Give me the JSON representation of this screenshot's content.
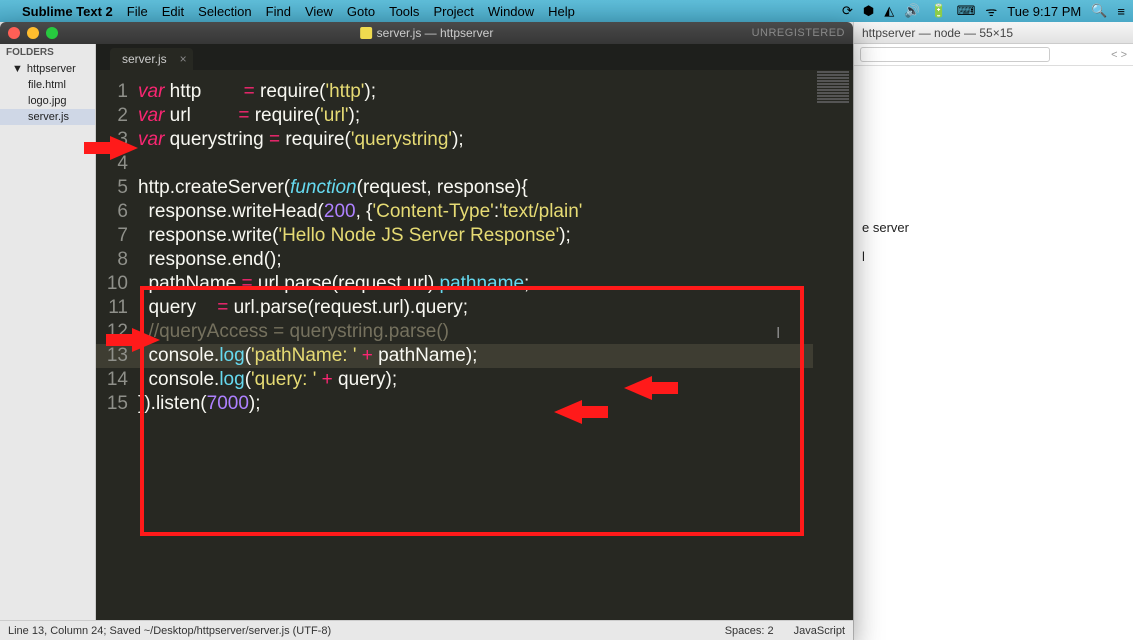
{
  "menubar": {
    "app": "Sublime Text 2",
    "items": [
      "File",
      "Edit",
      "Selection",
      "Find",
      "View",
      "Goto",
      "Tools",
      "Project",
      "Window",
      "Help"
    ],
    "clock": "Tue 9:17 PM"
  },
  "sublime": {
    "title": "server.js — httpserver",
    "unregistered": "UNREGISTERED",
    "sidebar": {
      "header": "FOLDERS",
      "folder": "httpserver",
      "files": [
        "file.html",
        "logo.jpg",
        "server.js"
      ],
      "selected": "server.js"
    },
    "tab": {
      "label": "server.js"
    },
    "status": {
      "left": "Line 13, Column 24; Saved ~/Desktop/httpserver/server.js (UTF-8)",
      "spaces": "Spaces: 2",
      "lang": "JavaScript"
    },
    "code": {
      "l1": {
        "n": "1",
        "pre": "",
        "a": "var",
        "b": " http        ",
        "c": "=",
        "d": " require(",
        "e": "'http'",
        "f": ");"
      },
      "l2": {
        "n": "2",
        "pre": "",
        "a": "var",
        "b": " url         ",
        "c": "=",
        "d": " require(",
        "e": "'url'",
        "f": ");"
      },
      "l3": {
        "n": "3",
        "pre": "",
        "a": "var",
        "b": " querystring ",
        "c": "=",
        "d": " require(",
        "e": "'querystring'",
        "f": ");"
      },
      "l4": {
        "n": "4"
      },
      "l5": {
        "n": "5",
        "a": "http.createServer(",
        "b": "function",
        "c": "(request, response){"
      },
      "l6": {
        "n": "6",
        "a": "  response.writeHead(",
        "b": "200",
        "c": ", {",
        "d": "'Content-Type'",
        "e": ":",
        "f": "'text/plain'"
      },
      "l7": {
        "n": "7",
        "a": "  response.write(",
        "b": "'Hello Node JS Server Response'",
        "c": ");"
      },
      "l8": {
        "n": "8",
        "a": "  response.end();"
      },
      "l10": {
        "n": "10",
        "a": "  pathName ",
        "b": "=",
        "c": " url.parse(request.url).",
        "d": "pathname",
        "e": ";"
      },
      "l11": {
        "n": "11",
        "a": "  query    ",
        "b": "=",
        "c": " url.parse(request.url).query;"
      },
      "l12": {
        "n": "12",
        "a": "  //queryAccess = querystring.parse()"
      },
      "l13": {
        "n": "13",
        "a": "  console.",
        "b": "log",
        "c": "(",
        "d": "'pathName: '",
        "e": " + ",
        "f": "pathName);"
      },
      "l14": {
        "n": "14",
        "a": "  console.",
        "b": "log",
        "c": "(",
        "d": "'query: '",
        "e": " + ",
        "f": "query);"
      },
      "l15": {
        "n": "15",
        "a": "}).listen(",
        "b": "7000",
        "c": ");"
      }
    }
  },
  "terminal": {
    "title": "httpserver — node — 55×15",
    "line1": "e server",
    "line2": "l"
  }
}
